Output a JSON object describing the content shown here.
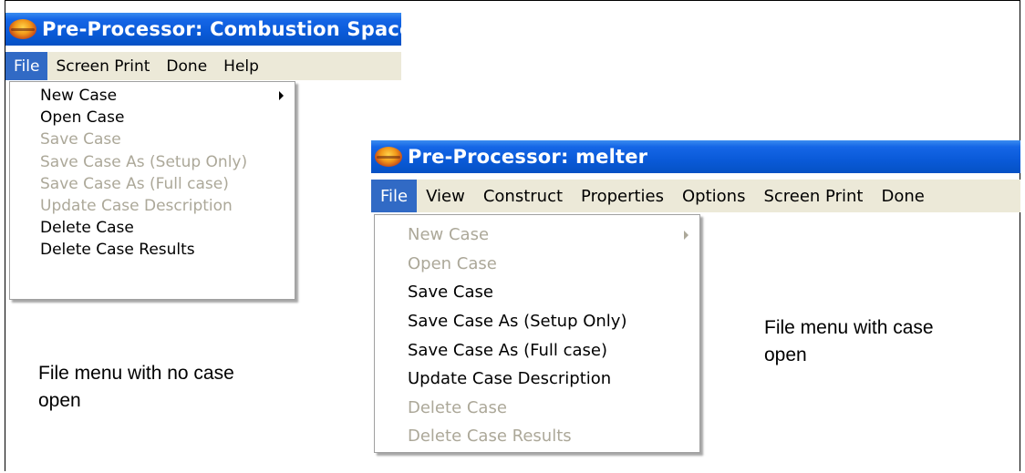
{
  "window_1": {
    "title": "Pre-Processor: Combustion Space",
    "menu": [
      "File",
      "Screen Print",
      "Done",
      "Help"
    ],
    "active_menu": "File",
    "file_menu_items": [
      {
        "label": "New Case",
        "enabled": true,
        "submenu": true
      },
      {
        "label": "Open Case",
        "enabled": true,
        "submenu": false
      },
      {
        "label": "Save Case",
        "enabled": false,
        "submenu": false
      },
      {
        "label": "Save Case As (Setup Only)",
        "enabled": false,
        "submenu": false
      },
      {
        "label": "Save Case As (Full case)",
        "enabled": false,
        "submenu": false
      },
      {
        "label": "Update Case Description",
        "enabled": false,
        "submenu": false
      },
      {
        "label": "Delete Case",
        "enabled": true,
        "submenu": false
      },
      {
        "label": "Delete Case Results",
        "enabled": true,
        "submenu": false
      }
    ]
  },
  "window_2": {
    "title": "Pre-Processor: melter",
    "menu": [
      "File",
      "View",
      "Construct",
      "Properties",
      "Options",
      "Screen Print",
      "Done"
    ],
    "active_menu": "File",
    "file_menu_items": [
      {
        "label": "New Case",
        "enabled": false,
        "submenu": true
      },
      {
        "label": "Open Case",
        "enabled": false,
        "submenu": false
      },
      {
        "label": "Save Case",
        "enabled": true,
        "submenu": false
      },
      {
        "label": "Save Case As (Setup Only)",
        "enabled": true,
        "submenu": false
      },
      {
        "label": "Save Case As (Full case)",
        "enabled": true,
        "submenu": false
      },
      {
        "label": "Update Case Description",
        "enabled": true,
        "submenu": false
      },
      {
        "label": "Delete Case",
        "enabled": false,
        "submenu": false
      },
      {
        "label": "Delete Case Results",
        "enabled": false,
        "submenu": false
      }
    ]
  },
  "captions": {
    "no_case": "File menu with no case open",
    "case_open": "File menu with case open"
  },
  "icons": {
    "app_logo": "app-logo-icon",
    "submenu_arrow": "submenu-arrow-icon"
  },
  "colors": {
    "titlebar": "#0a5ad8",
    "menubar": "#ece9d8",
    "active_menu": "#316ac5",
    "disabled_text": "#aca899"
  }
}
